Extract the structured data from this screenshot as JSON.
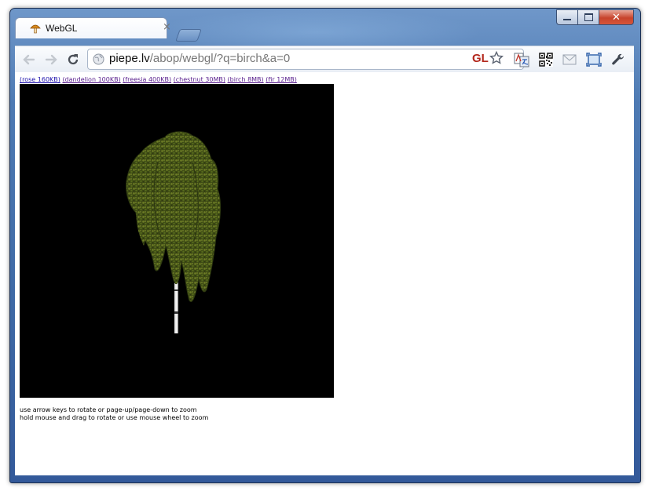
{
  "browser": {
    "tab": {
      "title": "WebGL",
      "close_glyph": "×"
    },
    "window_controls": {
      "close_glyph": "✕"
    },
    "address": {
      "host": "piepe.lv",
      "path": "/abop/webgl/?q=birch&a=0"
    },
    "extension_badge": "GL",
    "accent_colors": {
      "gl_badge": "#b3271c",
      "link": "#1a0dab"
    }
  },
  "page": {
    "links": [
      {
        "label": "(rose 160KB)"
      },
      {
        "label": "(dandelion 100KB)"
      },
      {
        "label": "(freesia 400KB)"
      },
      {
        "label": "(chestnut 30MB)"
      },
      {
        "label": "(birch 8MB)"
      },
      {
        "label": "(fir 12MB)"
      }
    ],
    "help_lines": [
      "use arrow keys to rotate or page-up/page-down to zoom",
      "hold mouse and drag to rotate or use mouse wheel to zoom"
    ]
  }
}
